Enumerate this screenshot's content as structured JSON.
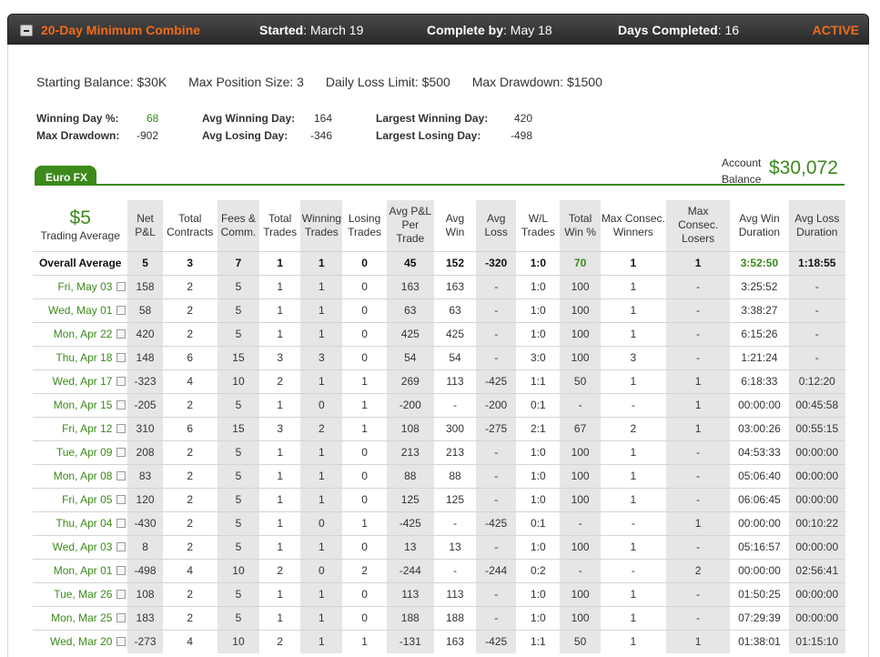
{
  "header": {
    "title": "20-Day Minimum Combine",
    "started_label": "Started",
    "started_value": ": March 19",
    "complete_label": "Complete by",
    "complete_value": ": May 18",
    "days_label": "Days Completed",
    "days_value": ": 16",
    "status": "ACTIVE"
  },
  "summary": {
    "starting_balance": "Starting Balance: $30K",
    "max_position": "Max Position Size: 3",
    "daily_loss": "Daily Loss Limit: $500",
    "max_drawdown": "Max Drawdown: $1500"
  },
  "stats": {
    "winning_day_pct_label": "Winning Day %:",
    "winning_day_pct": "68",
    "max_drawdown_label": "Max Drawdown:",
    "max_drawdown": "-902",
    "avg_winning_day_label": "Avg Winning Day:",
    "avg_winning_day": "164",
    "avg_losing_day_label": "Avg Losing Day:",
    "avg_losing_day": "-346",
    "largest_winning_day_label": "Largest Winning Day:",
    "largest_winning_day": "420",
    "largest_losing_day_label": "Largest Losing Day:",
    "largest_losing_day": "-498"
  },
  "tab_label": "Euro FX",
  "account": {
    "label_line1": "Account",
    "label_line2": "Balance",
    "value": "$30,072"
  },
  "trading_average": {
    "value": "$5",
    "label": "Trading Average"
  },
  "columns": [
    "Net P&L",
    "Total Contracts",
    "Fees & Comm.",
    "Total Trades",
    "Winning Trades",
    "Losing Trades",
    "Avg P&L Per Trade",
    "Avg Win",
    "Avg Loss",
    "W/L Trades",
    "Total Win %",
    "Max Consec. Winners",
    "Max Consec. Losers",
    "Avg Win Duration",
    "Avg Loss Duration"
  ],
  "overall_average": {
    "label": "Overall Average",
    "values": [
      "5",
      "3",
      "7",
      "1",
      "1",
      "0",
      "45",
      "152",
      "-320",
      "1:0",
      "70",
      "1",
      "1",
      "3:52:50",
      "1:18:55"
    ]
  },
  "rows": [
    {
      "date": "Fri, May 03",
      "values": [
        "158",
        "2",
        "5",
        "1",
        "1",
        "0",
        "163",
        "163",
        "-",
        "1:0",
        "100",
        "1",
        "-",
        "3:25:52",
        "-"
      ]
    },
    {
      "date": "Wed, May 01",
      "values": [
        "58",
        "2",
        "5",
        "1",
        "1",
        "0",
        "63",
        "63",
        "-",
        "1:0",
        "100",
        "1",
        "-",
        "3:38:27",
        "-"
      ]
    },
    {
      "date": "Mon, Apr 22",
      "values": [
        "420",
        "2",
        "5",
        "1",
        "1",
        "0",
        "425",
        "425",
        "-",
        "1:0",
        "100",
        "1",
        "-",
        "6:15:26",
        "-"
      ]
    },
    {
      "date": "Thu, Apr 18",
      "values": [
        "148",
        "6",
        "15",
        "3",
        "3",
        "0",
        "54",
        "54",
        "-",
        "3:0",
        "100",
        "3",
        "-",
        "1:21:24",
        "-"
      ]
    },
    {
      "date": "Wed, Apr 17",
      "values": [
        "-323",
        "4",
        "10",
        "2",
        "1",
        "1",
        "269",
        "113",
        "-425",
        "1:1",
        "50",
        "1",
        "1",
        "6:18:33",
        "0:12:20"
      ]
    },
    {
      "date": "Mon, Apr 15",
      "values": [
        "-205",
        "2",
        "5",
        "1",
        "0",
        "1",
        "-200",
        "-",
        "-200",
        "0:1",
        "-",
        "-",
        "1",
        "00:00:00",
        "00:45:58"
      ]
    },
    {
      "date": "Fri, Apr 12",
      "values": [
        "310",
        "6",
        "15",
        "3",
        "2",
        "1",
        "108",
        "300",
        "-275",
        "2:1",
        "67",
        "2",
        "1",
        "03:00:26",
        "00:55:15"
      ]
    },
    {
      "date": "Tue, Apr 09",
      "values": [
        "208",
        "2",
        "5",
        "1",
        "1",
        "0",
        "213",
        "213",
        "-",
        "1:0",
        "100",
        "1",
        "-",
        "04:53:33",
        "00:00:00"
      ]
    },
    {
      "date": "Mon, Apr 08",
      "values": [
        "83",
        "2",
        "5",
        "1",
        "1",
        "0",
        "88",
        "88",
        "-",
        "1:0",
        "100",
        "1",
        "-",
        "05:06:40",
        "00:00:00"
      ]
    },
    {
      "date": "Fri, Apr 05",
      "values": [
        "120",
        "2",
        "5",
        "1",
        "1",
        "0",
        "125",
        "125",
        "-",
        "1:0",
        "100",
        "1",
        "-",
        "06:06:45",
        "00:00:00"
      ]
    },
    {
      "date": "Thu, Apr 04",
      "values": [
        "-430",
        "2",
        "5",
        "1",
        "0",
        "1",
        "-425",
        "-",
        "-425",
        "0:1",
        "-",
        "-",
        "1",
        "00:00:00",
        "00:10:22"
      ]
    },
    {
      "date": "Wed, Apr 03",
      "values": [
        "8",
        "2",
        "5",
        "1",
        "1",
        "0",
        "13",
        "13",
        "-",
        "1:0",
        "100",
        "1",
        "-",
        "05:16:57",
        "00:00:00"
      ]
    },
    {
      "date": "Mon, Apr 01",
      "values": [
        "-498",
        "4",
        "10",
        "2",
        "0",
        "2",
        "-244",
        "-",
        "-244",
        "0:2",
        "-",
        "-",
        "2",
        "00:00:00",
        "02:56:41"
      ]
    },
    {
      "date": "Tue, Mar 26",
      "values": [
        "108",
        "2",
        "5",
        "1",
        "1",
        "0",
        "113",
        "113",
        "-",
        "1:0",
        "100",
        "1",
        "-",
        "01:50:25",
        "00:00:00"
      ]
    },
    {
      "date": "Mon, Mar 25",
      "values": [
        "183",
        "2",
        "5",
        "1",
        "1",
        "0",
        "188",
        "188",
        "-",
        "1:0",
        "100",
        "1",
        "-",
        "07:29:39",
        "00:00:00"
      ]
    },
    {
      "date": "Wed, Mar 20",
      "values": [
        "-273",
        "4",
        "10",
        "2",
        "1",
        "1",
        "-131",
        "163",
        "-425",
        "1:1",
        "50",
        "1",
        "1",
        "01:38:01",
        "01:15:10"
      ]
    }
  ],
  "colors": {
    "accent_green": "#3b8a1a",
    "accent_orange": "#f26b1d",
    "header_bg": "#333333"
  }
}
